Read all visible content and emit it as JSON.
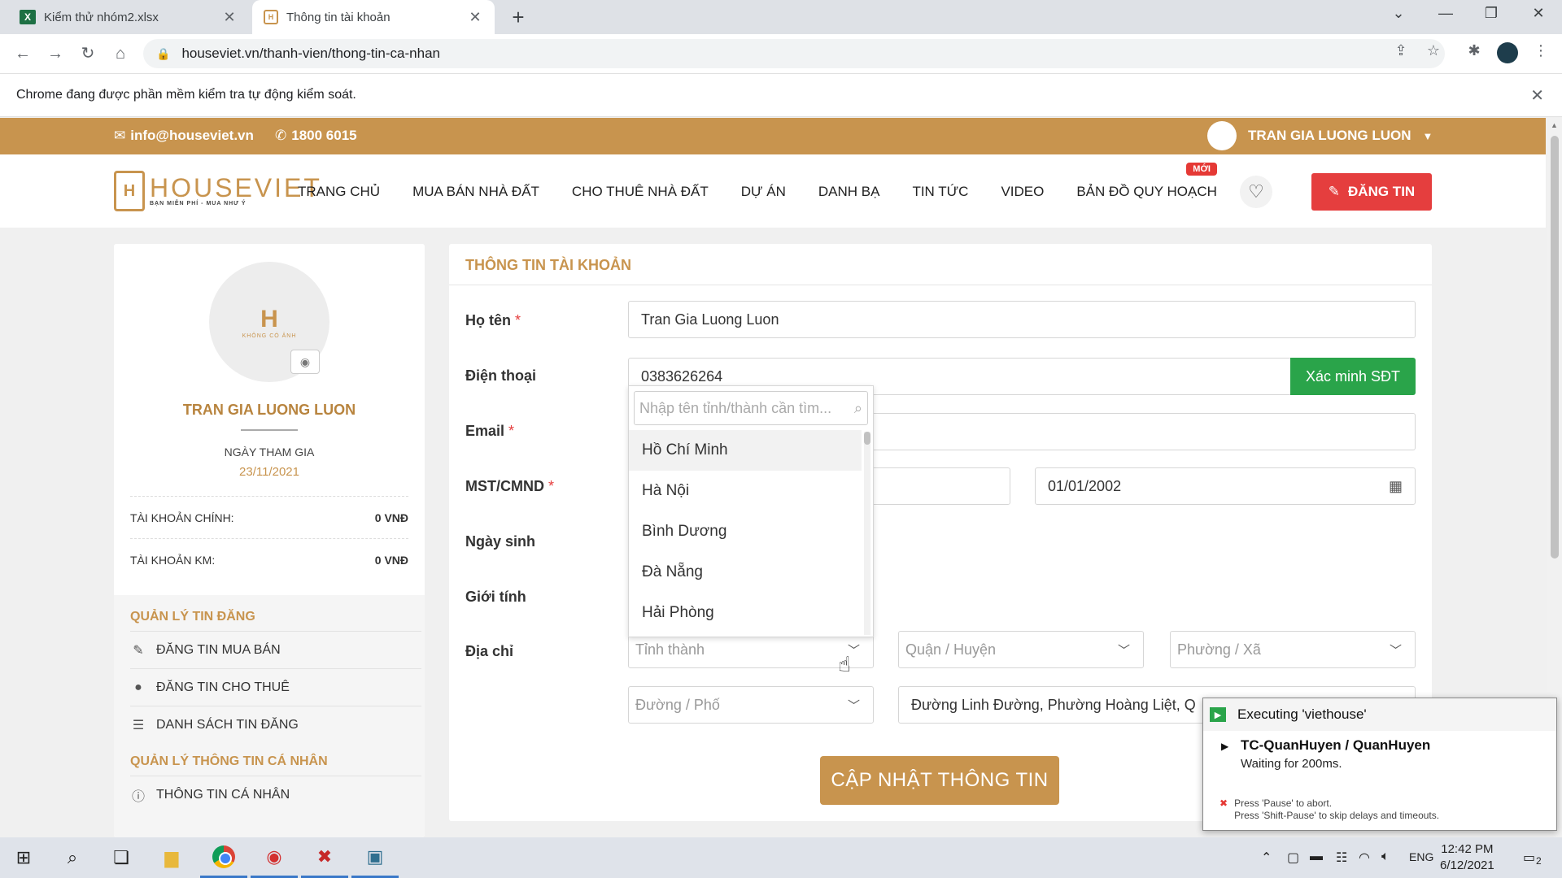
{
  "browser": {
    "tabs": [
      {
        "title": "Kiểm thử nhóm2.xlsx",
        "icon": "excel-icon",
        "active": false
      },
      {
        "title": "Thông tin tài khoản",
        "icon": "houseviet-favicon",
        "active": true
      }
    ],
    "url": "houseviet.vn/thanh-vien/thong-tin-ca-nhan",
    "infobar": "Chrome đang được phần mềm kiểm tra tự động kiểm soát."
  },
  "site": {
    "email": "info@houseviet.vn",
    "phone": "1800 6015",
    "user_name": "TRAN GIA LUONG LUON",
    "logo_text": "HOUSEVIET",
    "logo_tagline": "BẠN MIỄN PHÍ - MUA NHƯ Ý",
    "nav": [
      "TRANG CHỦ",
      "MUA BÁN NHÀ ĐẤT",
      "CHO THUÊ NHÀ ĐẤT",
      "DỰ ÁN",
      "DANH BẠ",
      "TIN TỨC",
      "VIDEO",
      "BẢN ĐỒ QUY HOẠCH"
    ],
    "new_badge": "MỚI",
    "post_button": "ĐĂNG TIN"
  },
  "sidebar": {
    "avatar_caption": "KHÔNG CÓ ẢNH",
    "name": "TRAN GIA LUONG LUON",
    "join_label": "NGÀY THAM GIA",
    "join_date": "23/11/2021",
    "main_account_label": "TÀI KHOẢN CHÍNH:",
    "main_account_value": "0 VNĐ",
    "promo_account_label": "TÀI KHOẢN KM:",
    "promo_account_value": "0 VNĐ",
    "section_posts": "QUẢN LÝ TIN ĐĂNG",
    "post_items": [
      "ĐĂNG TIN MUA BÁN",
      "ĐĂNG TIN CHO THUÊ",
      "DANH SÁCH TIN ĐĂNG"
    ],
    "section_personal": "QUẢN LÝ THÔNG TIN CÁ NHÂN",
    "personal_items": [
      "THÔNG TIN CÁ NHÂN"
    ]
  },
  "form": {
    "title": "THÔNG TIN TÀI KHOẢN",
    "fullname_label": "Họ tên",
    "fullname_value": "Tran Gia Luong Luon",
    "phone_label": "Điện thoại",
    "phone_value": "0383626264",
    "verify_button": "Xác minh SĐT",
    "email_label": "Email",
    "idcard_label": "MST/CMND",
    "date_value": "01/01/2002",
    "birthday_label": "Ngày sinh",
    "gender_label": "Giới tính",
    "address_label": "Địa chỉ",
    "province_placeholder": "Tỉnh thành",
    "district_placeholder": "Quận / Huyện",
    "ward_placeholder": "Phường / Xã",
    "street_placeholder": "Đường / Phố",
    "address_value": "Đường Linh Đường, Phường Hoàng Liệt, Q",
    "required_mark": "*",
    "update_button": "CẬP NHẬT THÔNG TIN"
  },
  "dropdown": {
    "search_placeholder": "Nhập tên tỉnh/thành cần tìm...",
    "options": [
      "Hồ Chí Minh",
      "Hà Nội",
      "Bình Dương",
      "Đà Nẵng",
      "Hải Phòng"
    ],
    "highlighted_index": 0
  },
  "katalon": {
    "executing": "Executing 'viethouse'",
    "testcase": "TC-QuanHuyen / QuanHuyen",
    "status": "Waiting for 200ms.",
    "hint1": "Press 'Pause' to abort.",
    "hint2": "Press 'Shift-Pause' to skip delays and timeouts."
  },
  "taskbar": {
    "lang": "ENG",
    "time": "12:42 PM",
    "date": "6/12/2021",
    "notifications": "2"
  },
  "colors": {
    "brand": "#c8944e",
    "danger": "#e53e3e",
    "success": "#2aa44a"
  }
}
